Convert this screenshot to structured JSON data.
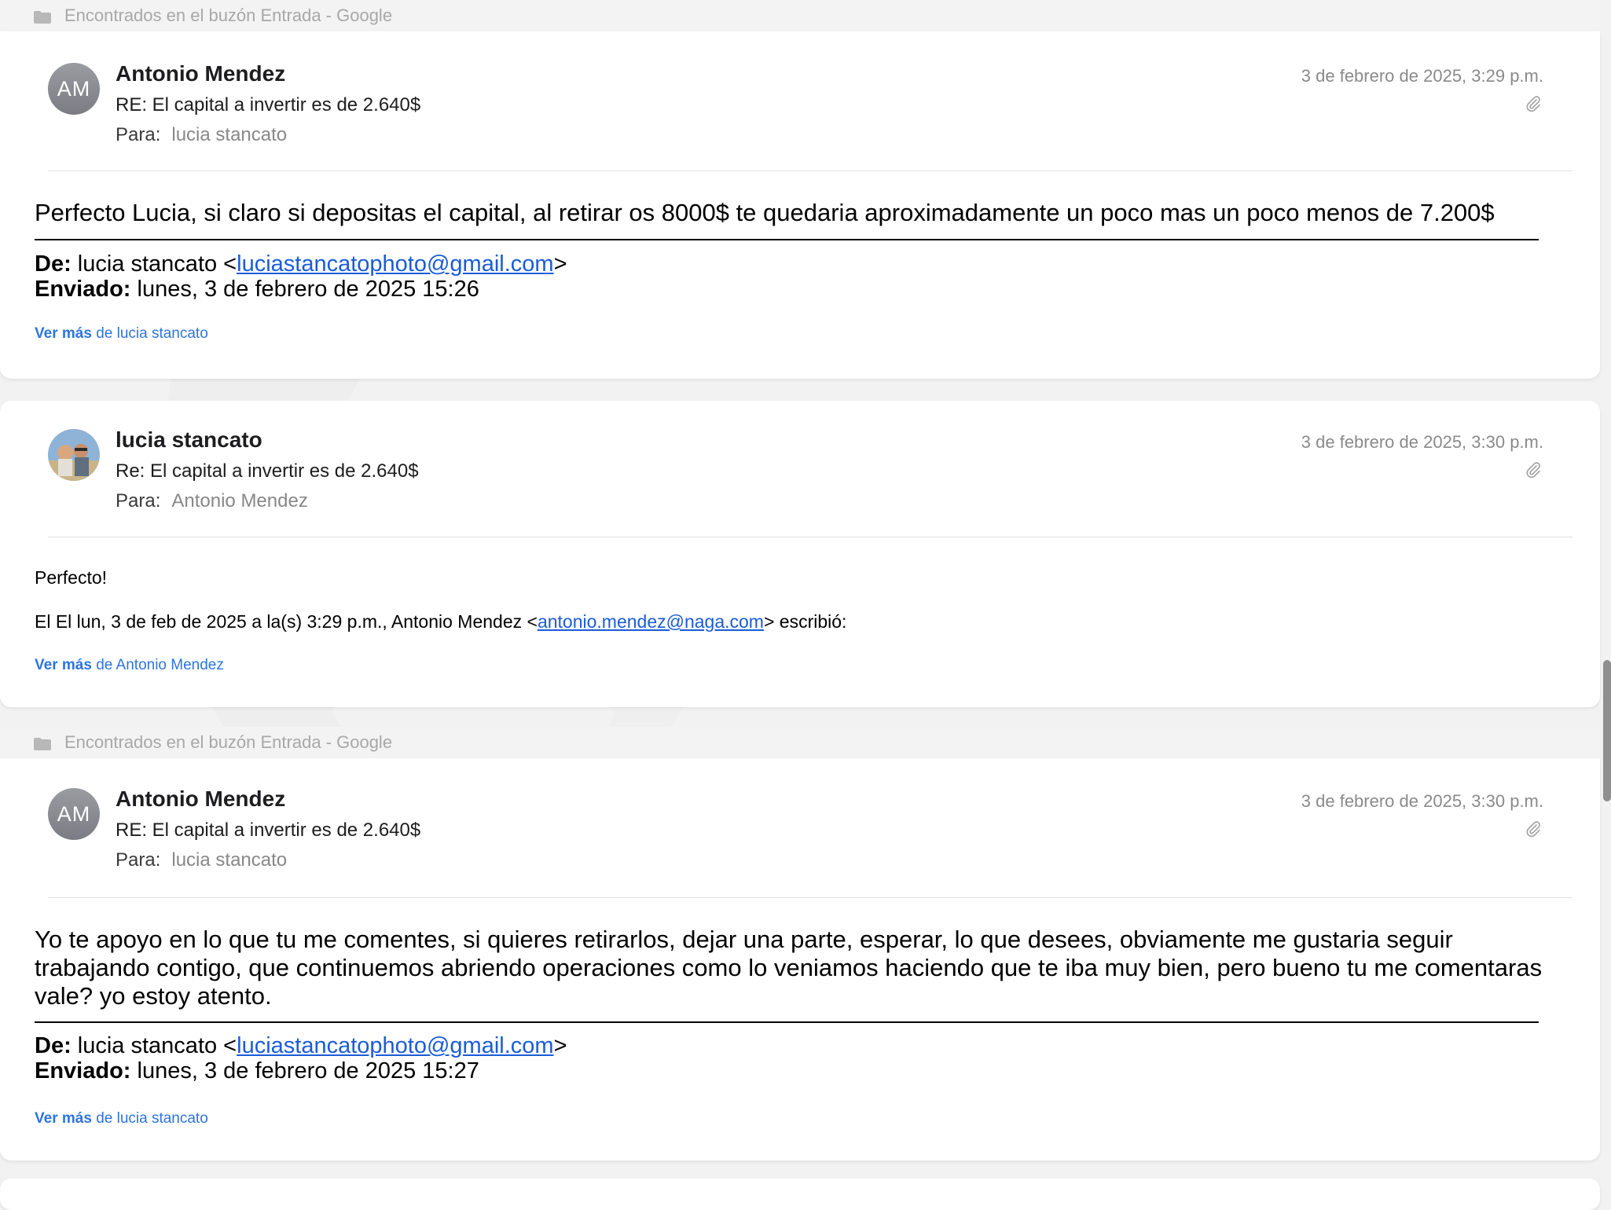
{
  "messages": [
    {
      "folder": "Encontrados en el buzón Entrada - Google",
      "avatar_initials": "AM",
      "sender": "Antonio Mendez",
      "subject": "RE: El capital a invertir es de 2.640$",
      "to_label": "Para:",
      "to": "lucia stancato",
      "date": "3 de febrero de 2025, 3:29 p.m.",
      "attachment_icon": "paperclip-icon",
      "body": "Perfecto Lucia, si claro si depositas el capital, al retirar os 8000$ te quedaria aproximadamente un poco mas un poco menos de 7.200$",
      "quoted_from_label": "De:",
      "quoted_from_name": "lucia stancato <",
      "quoted_from_email": "luciastancatophoto@gmail.com",
      "quoted_from_close": ">",
      "quoted_sent_label": "Enviado:",
      "quoted_sent": "lunes, 3 de febrero de 2025 15:26",
      "ver_mas_bold": "Ver más",
      "ver_mas_rest": "de lucia stancato"
    },
    {
      "avatar_icon": "user-photo",
      "sender": "lucia stancato",
      "subject": "Re: El capital a invertir es de 2.640$",
      "to_label": "Para:",
      "to": "Antonio Mendez",
      "date": "3 de febrero de 2025, 3:30 p.m.",
      "attachment_icon": "paperclip-icon",
      "body": "Perfecto!",
      "quote_intro": "El El lun, 3 de feb de 2025 a la(s) 3:29 p.m., Antonio Mendez <",
      "quote_email": "antonio.mendez@naga.com",
      "quote_outro": "> escribió:",
      "ver_mas_bold": "Ver más",
      "ver_mas_rest": "de Antonio Mendez"
    },
    {
      "folder": "Encontrados en el buzón Entrada - Google",
      "avatar_initials": "AM",
      "sender": "Antonio Mendez",
      "subject": "RE: El capital a invertir es de 2.640$",
      "to_label": "Para:",
      "to": "lucia stancato",
      "date": "3 de febrero de 2025, 3:30 p.m.",
      "attachment_icon": "paperclip-icon",
      "body": "Yo te apoyo en lo que tu me comentes, si quieres retirarlos, dejar una parte, esperar, lo que desees, obviamente me gustaria seguir trabajando contigo, que continuemos abriendo operaciones como lo veniamos haciendo que te iba muy bien, pero bueno tu me comentaras vale? yo estoy atento.",
      "quoted_from_label": "De:",
      "quoted_from_name": "lucia stancato <",
      "quoted_from_email": "luciastancatophoto@gmail.com",
      "quoted_from_close": ">",
      "quoted_sent_label": "Enviado:",
      "quoted_sent": "lunes, 3 de febrero de 2025 15:27",
      "ver_mas_bold": "Ver más",
      "ver_mas_rest": "de lucia stancato"
    }
  ]
}
